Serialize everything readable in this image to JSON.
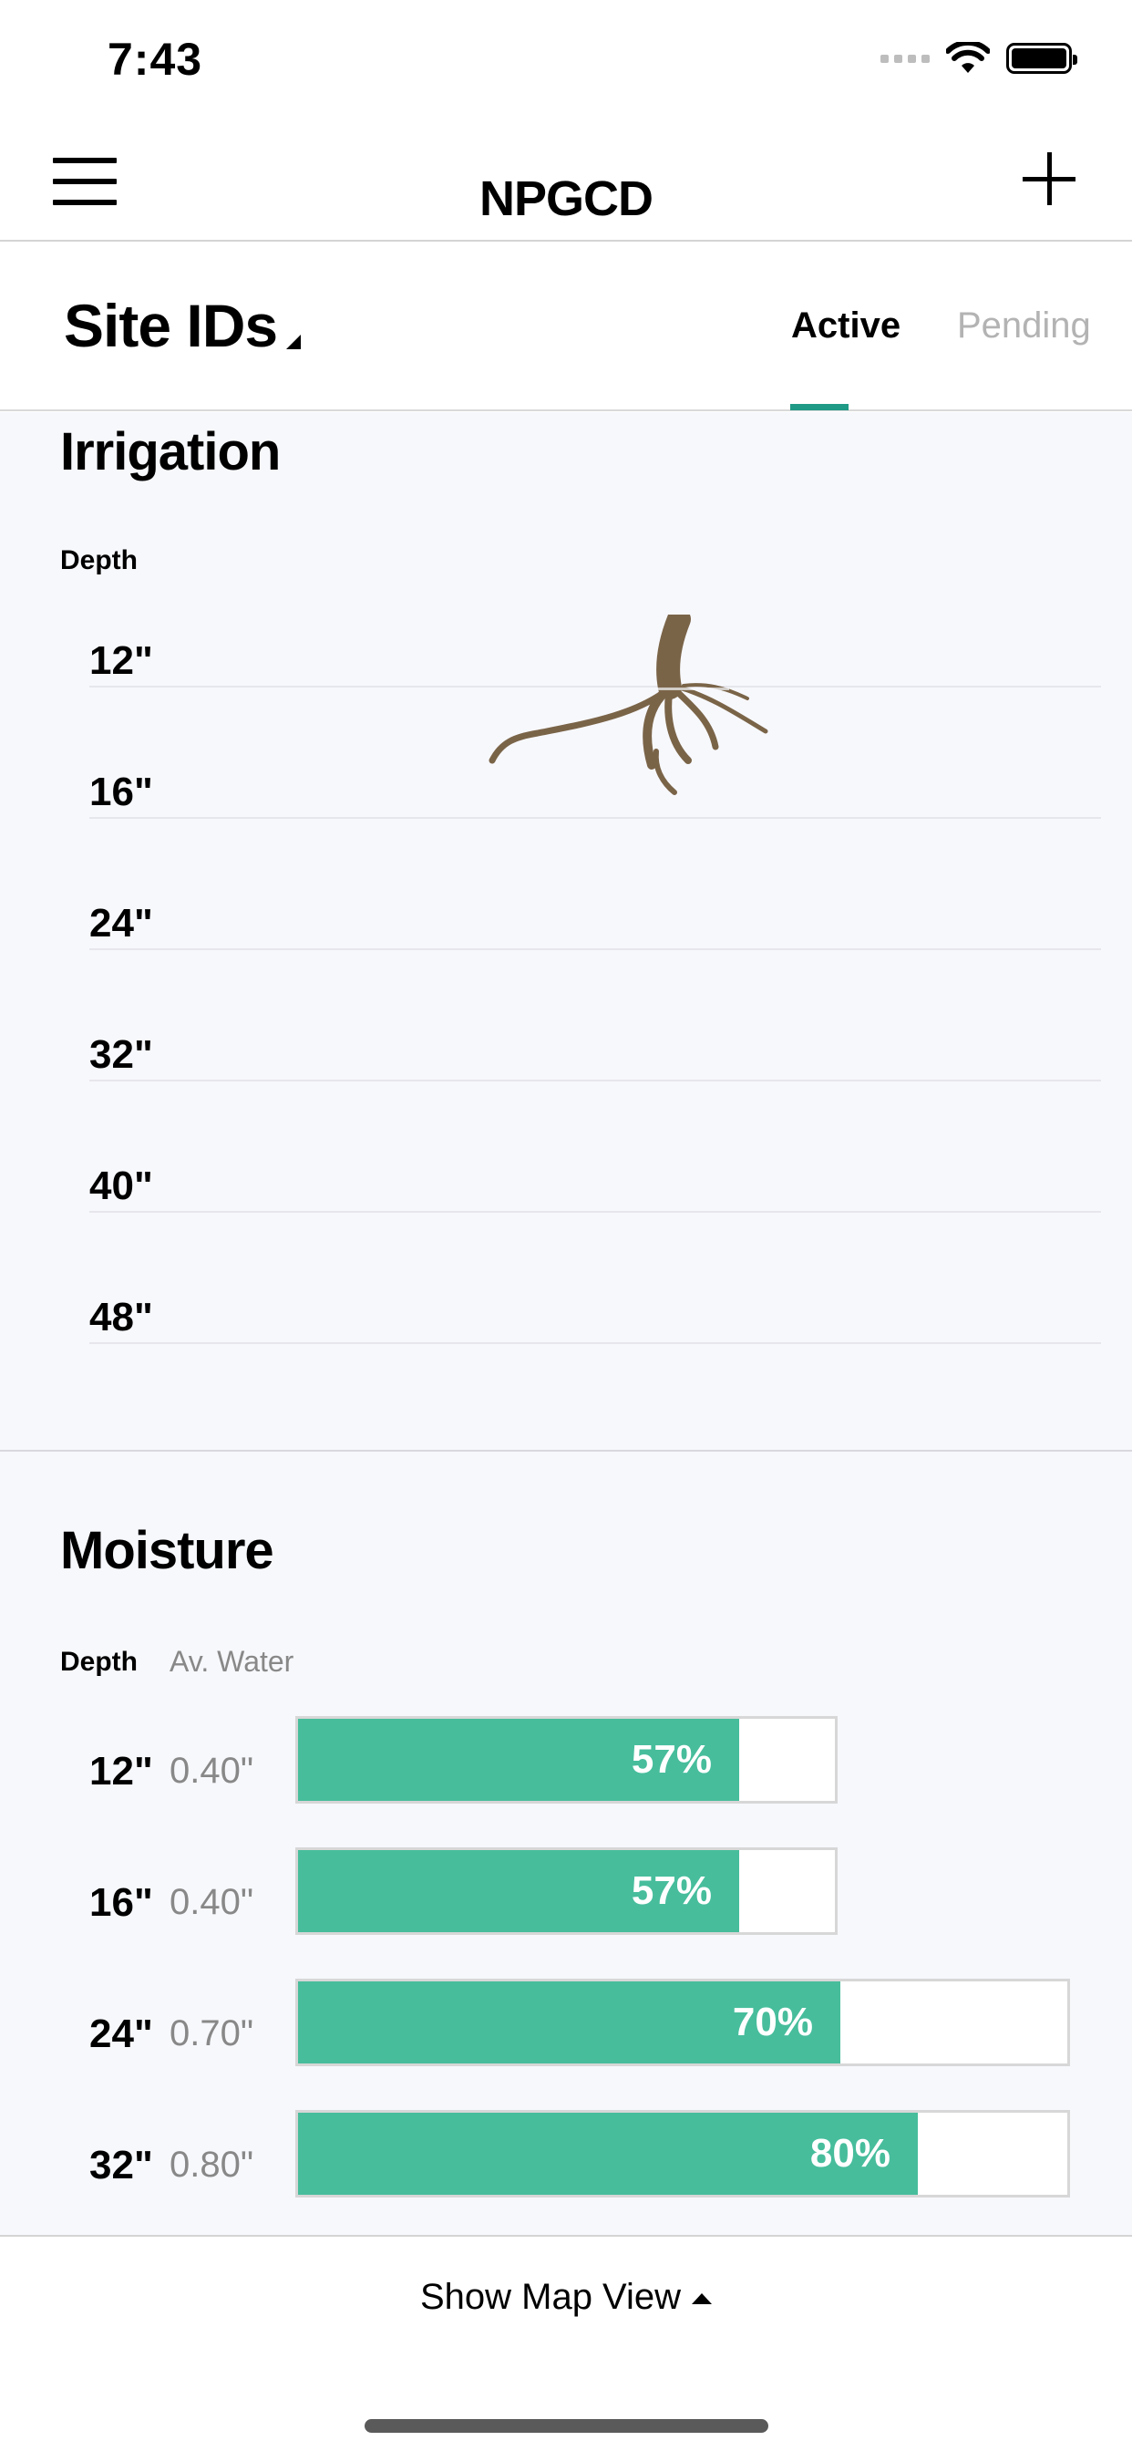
{
  "status_bar": {
    "time": "7:43"
  },
  "nav": {
    "title": "NPGCD"
  },
  "header": {
    "site_ids_label": "Site IDs",
    "tabs": [
      {
        "label": "Active",
        "active": true
      },
      {
        "label": "Pending",
        "active": false
      }
    ]
  },
  "irrigation": {
    "title": "Irrigation",
    "depth_header": "Depth",
    "depths": [
      "12\"",
      "16\"",
      "24\"",
      "32\"",
      "40\"",
      "48\""
    ]
  },
  "moisture": {
    "title": "Moisture",
    "depth_header": "Depth",
    "water_header": "Av. Water",
    "rows": [
      {
        "depth": "12\"",
        "water": "0.40\"",
        "percent_label": "57%",
        "fill_fraction": 0.57,
        "capacity": 0.7
      },
      {
        "depth": "16\"",
        "water": "0.40\"",
        "percent_label": "57%",
        "fill_fraction": 0.57,
        "capacity": 0.7
      },
      {
        "depth": "24\"",
        "water": "0.70\"",
        "percent_label": "70%",
        "fill_fraction": 0.7,
        "capacity": 1.0
      },
      {
        "depth": "32\"",
        "water": "0.80\"",
        "percent_label": "80%",
        "fill_fraction": 0.8,
        "capacity": 1.0
      }
    ]
  },
  "bottom": {
    "show_map_label": "Show Map View"
  },
  "colors": {
    "accent": "#1f9a86",
    "bar_fill": "#47bd9c",
    "pending_tab": "#b3b3b3"
  }
}
